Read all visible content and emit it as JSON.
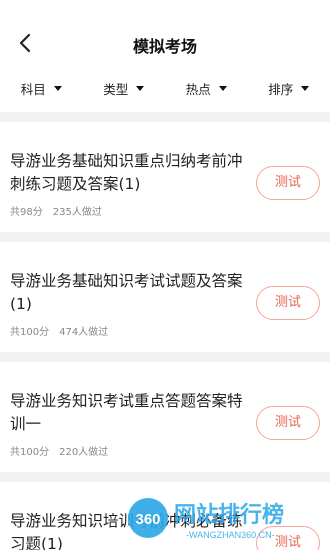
{
  "header": {
    "title": "模拟考场"
  },
  "filters": [
    {
      "label": "科目"
    },
    {
      "label": "类型"
    },
    {
      "label": "热点"
    },
    {
      "label": "排序"
    }
  ],
  "exams": [
    {
      "title": "导游业务基础知识重点归纳考前冲刺练习题及答案(1)",
      "score": "共98分",
      "count": "235人做过",
      "button": "测试"
    },
    {
      "title": "导游业务基础知识考试试题及答案(1)",
      "score": "共100分",
      "count": "474人做过",
      "button": "测试"
    },
    {
      "title": "导游业务知识考试重点答题答案特训一",
      "score": "共100分",
      "count": "220人做过",
      "button": "测试"
    },
    {
      "title": "导游业务知识培训考前冲刺必备练习题(1)",
      "button": "测试"
    }
  ],
  "watermark": {
    "number": "360",
    "brand": "网站排行榜",
    "url": "-WANGZHAN360.CN-"
  },
  "colors": {
    "accent": "#e8664f",
    "accent_border": "#f2a79a",
    "background": "#f2f2f2"
  }
}
